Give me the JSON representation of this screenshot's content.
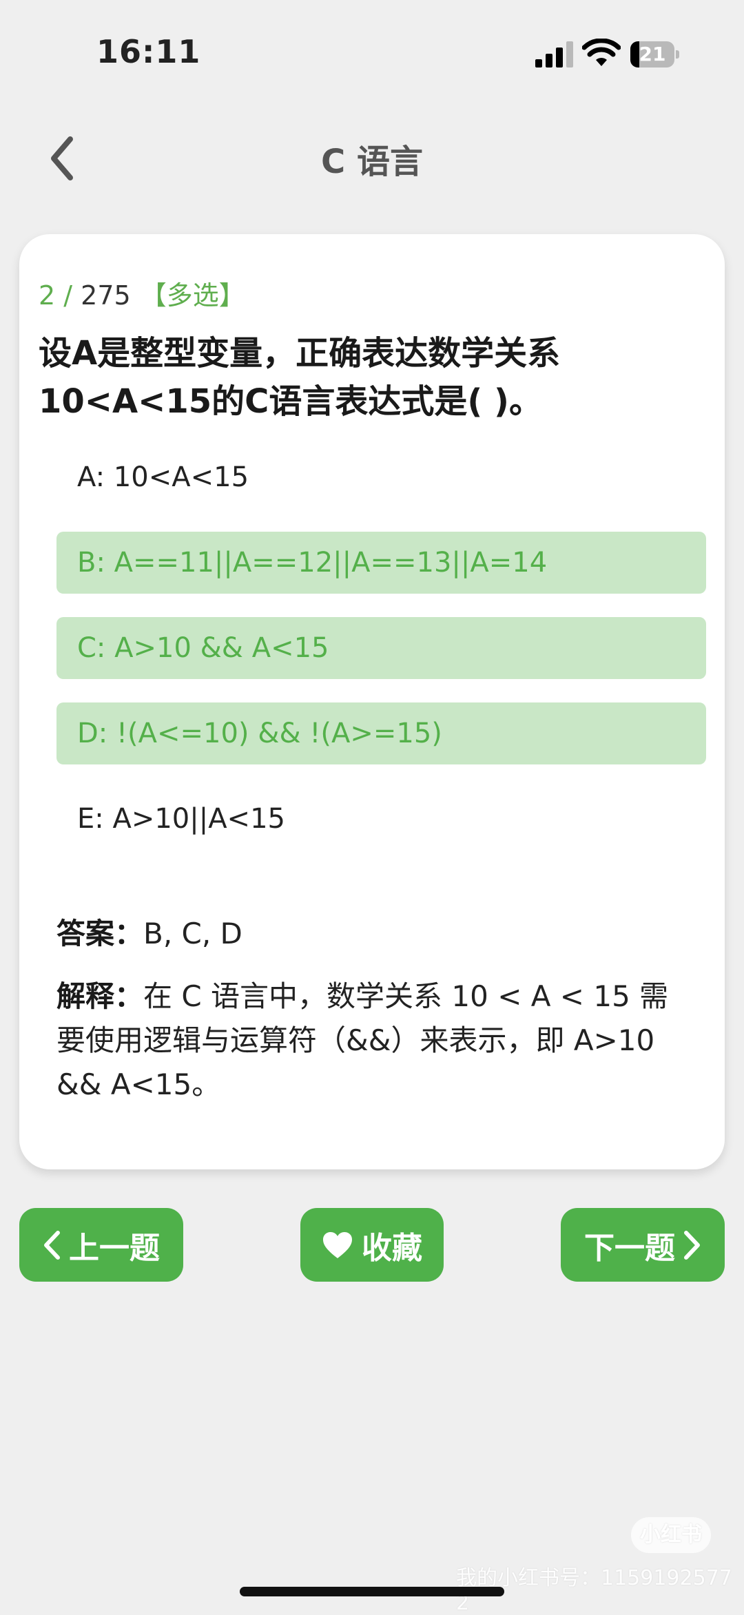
{
  "status": {
    "time": "16:11",
    "battery": "21",
    "battery_level": 0.21
  },
  "nav": {
    "title": "C 语言"
  },
  "question": {
    "index": "2",
    "separator": " / ",
    "total": "275",
    "type_tag": "【多选】",
    "text_line1": "设A是整型变量，正确表达数学关系",
    "text_line2": "10<A<15的C语言表达式是(  )。",
    "options": [
      {
        "text": "A: 10<A<15",
        "selected": false
      },
      {
        "text": "B: A==11||A==12||A==13||A=14",
        "selected": true
      },
      {
        "text": "C: A>10 && A<15",
        "selected": true
      },
      {
        "text": "D: !(A<=10) && !(A>=15)",
        "selected": true
      },
      {
        "text": "E: A>10||A<15",
        "selected": false
      }
    ],
    "answer_label": "答案：",
    "answer_value": "B, C, D",
    "explain_label": "解释：",
    "explain_text": "在 C 语言中，数学关系 10 < A < 15 需要使用逻辑与运算符（&&）来表示，即 A>10 && A<15。"
  },
  "buttons": {
    "prev": "上一题",
    "favorite": "收藏",
    "next": "下一题"
  },
  "watermark": {
    "logo": "小红书",
    "text": "我的小红书号：1159192577 2"
  },
  "colors": {
    "accent": "#4fb14a",
    "selected_bg": "#c9e7c6",
    "selected_text": "#54b04a"
  },
  "icons": {
    "back": "chevron-left-icon",
    "prev": "chevron-left-icon",
    "favorite": "heart-icon",
    "next": "chevron-right-icon",
    "signal": "cellular-signal-icon",
    "wifi": "wifi-icon",
    "battery": "battery-icon"
  }
}
